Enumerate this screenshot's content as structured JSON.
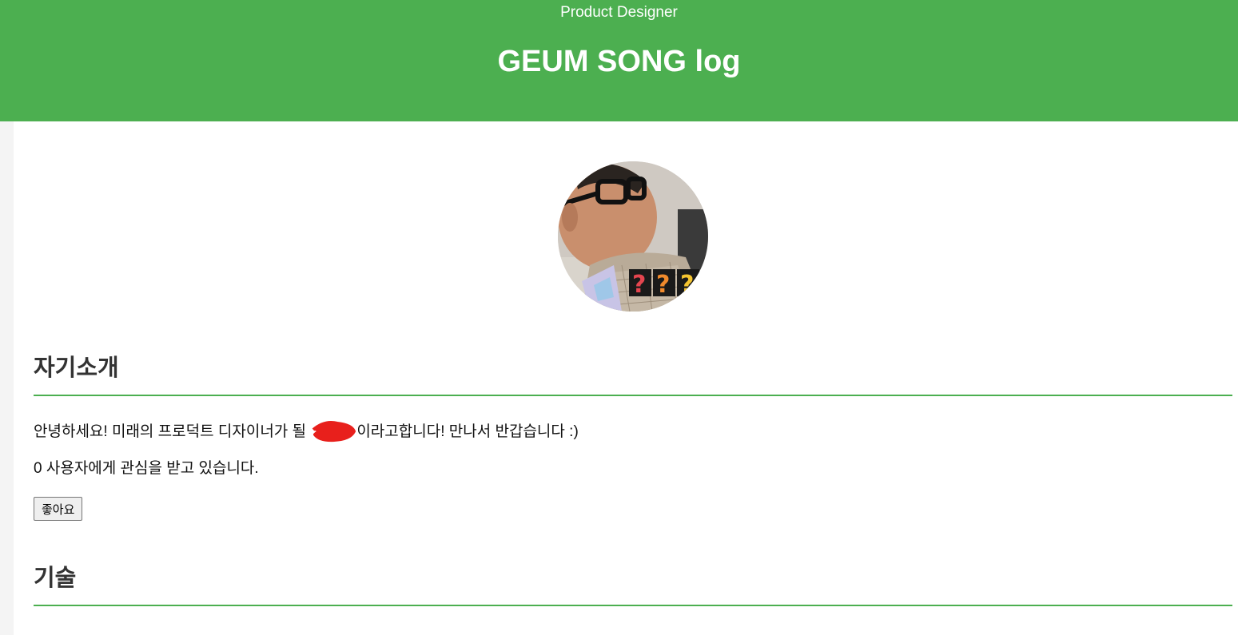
{
  "header": {
    "subtitle": "Product Designer",
    "title": "GEUM SONG log",
    "background_color": "#4caf50"
  },
  "profile": {
    "avatar_icon": "profile-photo"
  },
  "sections": {
    "intro": {
      "heading": "자기소개",
      "greeting_before": "안녕하세요! 미래의 프로덕트 디자이너가 될",
      "greeting_after": "이라고합니다! 만나서 반갑습니다 :)",
      "like_count": "0",
      "like_status": "사용자에게 관심을 받고 있습니다.",
      "like_button_label": "좋아요"
    },
    "skills": {
      "heading": "기술"
    }
  },
  "accent_color": "#4caf50"
}
